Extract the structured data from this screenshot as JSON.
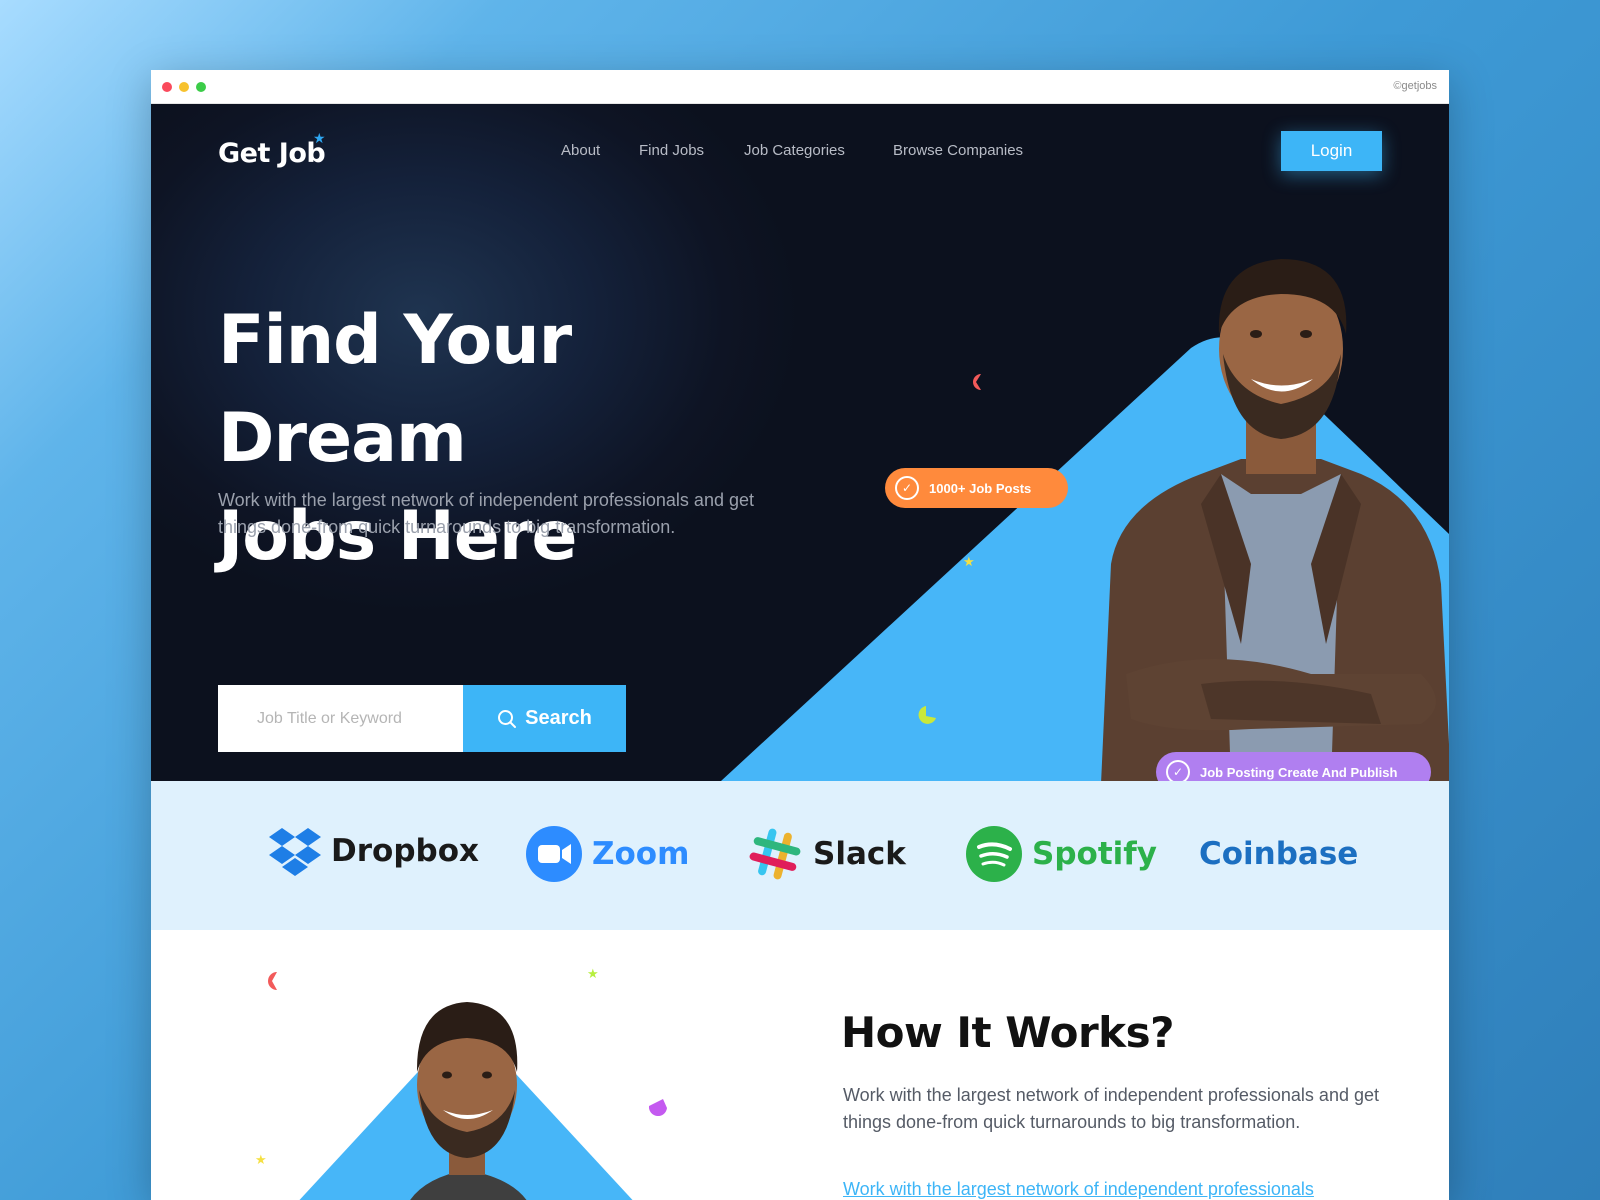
{
  "credit": "©getjobs",
  "header": {
    "logo": "Get Job",
    "nav": [
      "About",
      "Find Jobs",
      "Job Categories",
      "Browse Companies"
    ],
    "login": "Login"
  },
  "hero": {
    "title_line1": "Find Your Dream",
    "title_line2": "Jobs Here",
    "subtitle": "Work with the largest network of independent professionals and get things done-from quick turnarounds to big transformation.",
    "search_placeholder": "Job Title or Keyword",
    "search_button": "Search",
    "badge_posts": "1000+ Job Posts",
    "badge_publish": "Job Posting Create And Publish"
  },
  "companies": [
    "Dropbox",
    "Zoom",
    "Slack",
    "Spotify",
    "Coinbase"
  ],
  "how": {
    "title": "How It Works?",
    "text": "Work with the largest network of independent professionals and get things done-from quick turnarounds to big transformation.",
    "link": "Work with the largest network of independent professionals"
  },
  "colors": {
    "accent": "#3db5f7",
    "hero_bg": "#0e1424",
    "badge_orange": "#ff8a3c",
    "badge_purple": "#b07ff0",
    "logo_strip_bg": "#dff1fd",
    "dropbox": "#1e7ee6",
    "zoom": "#2d8cff",
    "spotify": "#2cb14a",
    "coinbase": "#1c6fc1"
  }
}
